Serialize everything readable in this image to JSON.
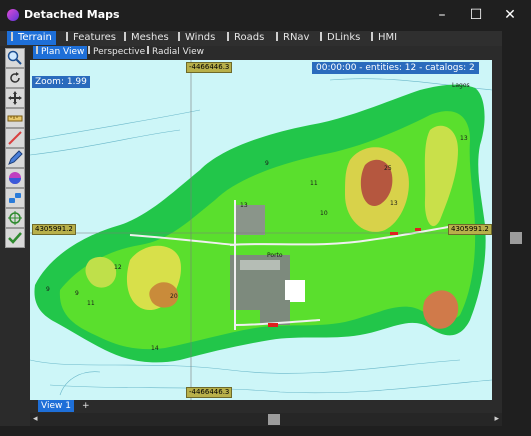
{
  "window": {
    "title": "Detached Maps",
    "min_glyph": "–",
    "max_glyph": "☐",
    "close_glyph": "✕"
  },
  "tabs": [
    "Terrain",
    "Features",
    "Meshes",
    "Winds",
    "Roads",
    "RNav",
    "DLinks",
    "HMI"
  ],
  "subtabs": [
    "Plan View",
    "Perspective",
    "Radial View"
  ],
  "toolbar_icons": [
    "magnifier-icon",
    "rotate-icon",
    "move-icon",
    "ruler-icon",
    "line-icon",
    "pencil-icon",
    "sphere-icon",
    "link-icon",
    "target-icon",
    "check-icon"
  ],
  "map": {
    "zoom": "Zoom: 1.99",
    "status": "00:00:00 - entities: 12 - catalogs: 2",
    "coord_top": "-4466446.3",
    "coord_bottom": "-4466446.3",
    "coord_left": "4305991.2",
    "coord_right": "4305991.2",
    "labels": {
      "porto": "Porto",
      "lagos": "Lagos",
      "top_right": "Lagos",
      "n1": "13",
      "n2": "11",
      "n3": "9",
      "n4": "10",
      "n5": "12",
      "n6": "9",
      "n7": "20",
      "n8": "11",
      "n9": "14",
      "n10": "9",
      "n11": "13",
      "n12": "25",
      "n13": "13"
    }
  },
  "view_tab": "View 1",
  "view_add": "+",
  "scroll": {
    "left": "◂",
    "right": "▸"
  }
}
